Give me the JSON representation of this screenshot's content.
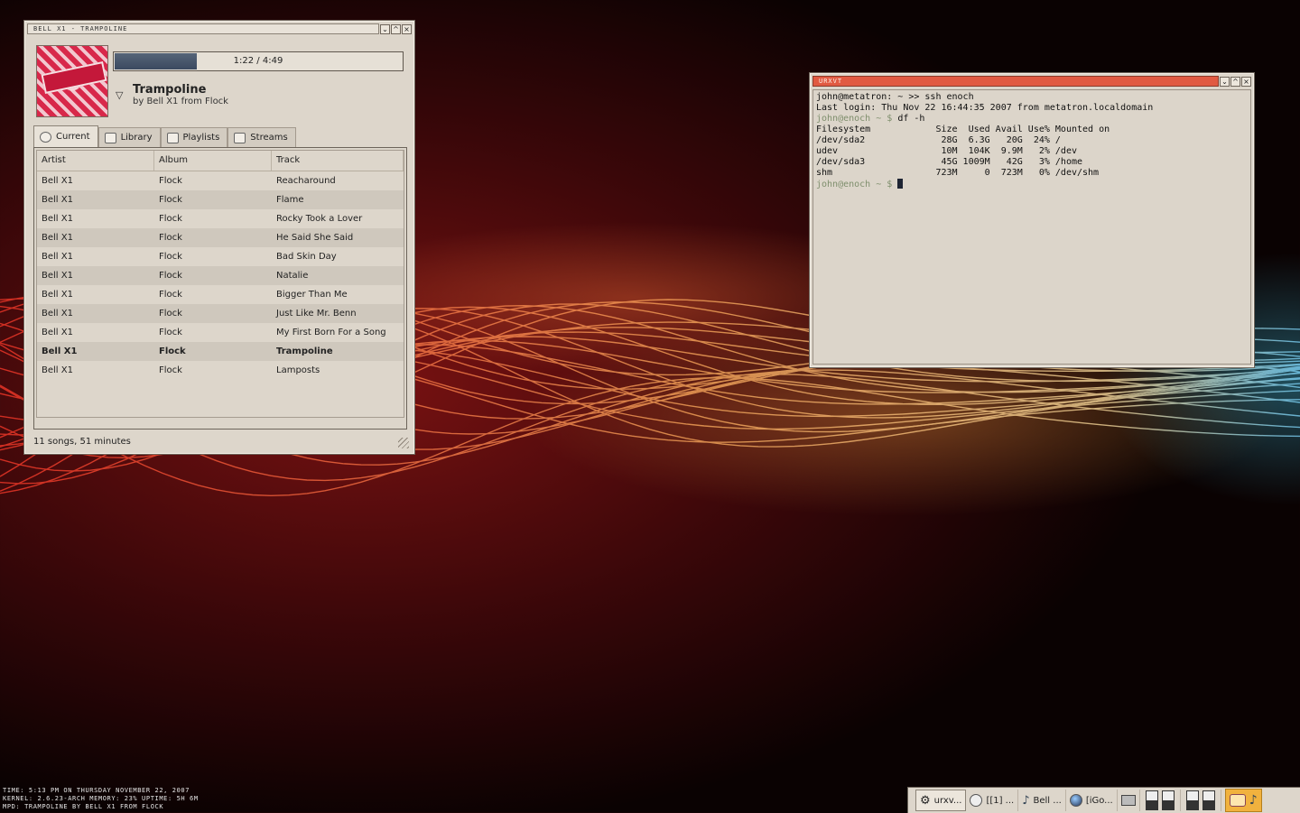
{
  "colors": {
    "terminal_titlebar": "#e15a42",
    "progress_fill": "#3b4a60",
    "window_bg": "#ddd6cb",
    "prompt": "#7f8f6d"
  },
  "music_window": {
    "title": "BELL X1 - TRAMPOLINE",
    "buttons": [
      "⌄",
      "^",
      "×"
    ],
    "progress": {
      "text": "1:22 / 4:49",
      "fraction": 0.283
    },
    "now_playing": {
      "title": "Trampoline",
      "subtitle": "by Bell X1 from Flock"
    },
    "tabs": [
      {
        "label": "Current",
        "icon": "cd-icon"
      },
      {
        "label": "Library",
        "icon": "library-icon"
      },
      {
        "label": "Playlists",
        "icon": "playlist-icon"
      },
      {
        "label": "Streams",
        "icon": "streams-icon"
      }
    ],
    "columns": [
      "Artist",
      "Album",
      "Track"
    ],
    "rows": [
      [
        "Bell X1",
        "Flock",
        "Reacharound"
      ],
      [
        "Bell X1",
        "Flock",
        "Flame"
      ],
      [
        "Bell X1",
        "Flock",
        "Rocky Took a Lover"
      ],
      [
        "Bell X1",
        "Flock",
        "He Said She Said"
      ],
      [
        "Bell X1",
        "Flock",
        "Bad Skin Day"
      ],
      [
        "Bell X1",
        "Flock",
        "Natalie"
      ],
      [
        "Bell X1",
        "Flock",
        "Bigger Than Me"
      ],
      [
        "Bell X1",
        "Flock",
        "Just Like Mr. Benn"
      ],
      [
        "Bell X1",
        "Flock",
        "My First Born For a Song"
      ],
      [
        "Bell X1",
        "Flock",
        "Trampoline"
      ],
      [
        "Bell X1",
        "Flock",
        "Lamposts"
      ]
    ],
    "current_row": 9,
    "status": "11 songs, 51 minutes"
  },
  "terminal": {
    "title": "URXVT",
    "buttons": [
      "⌄",
      "^",
      "×"
    ],
    "lines": [
      {
        "text": "john@metatron: ~ >> ssh enoch"
      },
      {
        "text": "Last login: Thu Nov 22 16:44:35 2007 from metatron.localdomain"
      },
      {
        "prompt": "john@enoch ~ $ ",
        "text": "df -h"
      },
      {
        "text": "Filesystem            Size  Used Avail Use% Mounted on"
      },
      {
        "text": "/dev/sda2              28G  6.3G   20G  24% /"
      },
      {
        "text": "udev                   10M  104K  9.9M   2% /dev"
      },
      {
        "text": "/dev/sda3              45G 1009M   42G   3% /home"
      },
      {
        "text": "shm                   723M     0  723M   0% /dev/shm"
      },
      {
        "prompt": "john@enoch ~ $ ",
        "text": "",
        "cursor": true
      }
    ]
  },
  "conky": [
    "TIME:  5:13 PM ON THURSDAY NOVEMBER 22, 2007",
    "KERNEL: 2.6.23-ARCH   MEMORY: 23%   UPTIME: 5H 6M",
    "MPD: TRAMPOLINE BY BELL X1 FROM FLOCK"
  ],
  "panel": {
    "tasks": [
      {
        "label": "urxv...",
        "icon": "gear-icon"
      },
      {
        "label": "[[1] ...",
        "icon": "clock-icon"
      },
      {
        "label": "Bell ...",
        "icon": "music-note-icon"
      },
      {
        "label": "[iGo...",
        "icon": "globe-icon"
      }
    ]
  }
}
